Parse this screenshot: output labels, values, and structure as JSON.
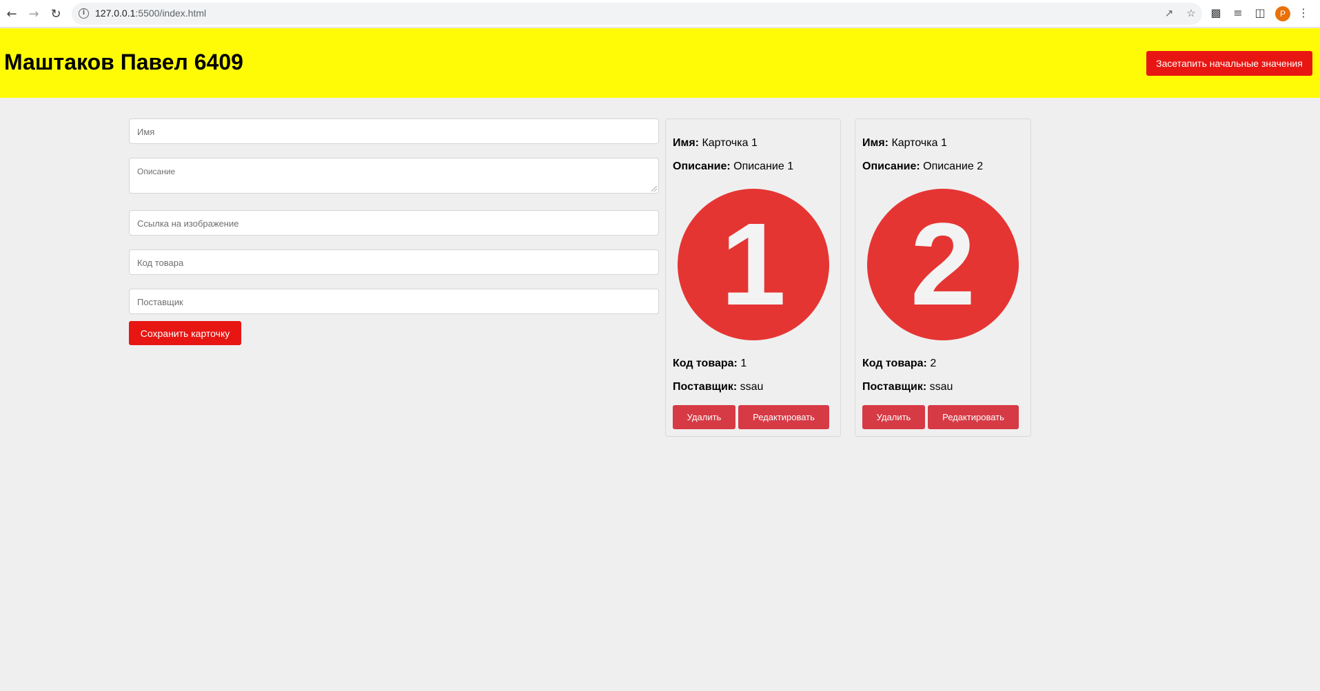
{
  "browser": {
    "url_host": "127.0.0.1",
    "url_path": ":5500/index.html",
    "profile_initial": "P"
  },
  "header": {
    "title": "Маштаков Павел 6409",
    "reset_label": "Засетапить начальные значения",
    "background": "#fffb07",
    "accent": "#e81612"
  },
  "form": {
    "name_placeholder": "Имя",
    "description_placeholder": "Описание",
    "image_placeholder": "Ссылка на изображение",
    "code_placeholder": "Код товара",
    "supplier_placeholder": "Поставщик",
    "save_label": "Сохранить карточку"
  },
  "cards": [
    {
      "name_label": "Имя:",
      "name": "Карточка 1",
      "description_label": "Описание:",
      "description": "Описание 1",
      "image_digit": "1",
      "code_label": "Код товара:",
      "code": "1",
      "supplier_label": "Поставщик:",
      "supplier": "ssau",
      "delete_label": "Удалить",
      "edit_label": "Редактировать"
    },
    {
      "name_label": "Имя:",
      "name": "Карточка 1",
      "description_label": "Описание:",
      "description": "Описание 2",
      "image_digit": "2",
      "code_label": "Код товара:",
      "code": "2",
      "supplier_label": "Поставщик:",
      "supplier": "ssau",
      "delete_label": "Удалить",
      "edit_label": "Редактировать"
    }
  ],
  "colors": {
    "page_bg": "#efefef",
    "card_button": "#d63a45",
    "badge": "#e53533"
  }
}
